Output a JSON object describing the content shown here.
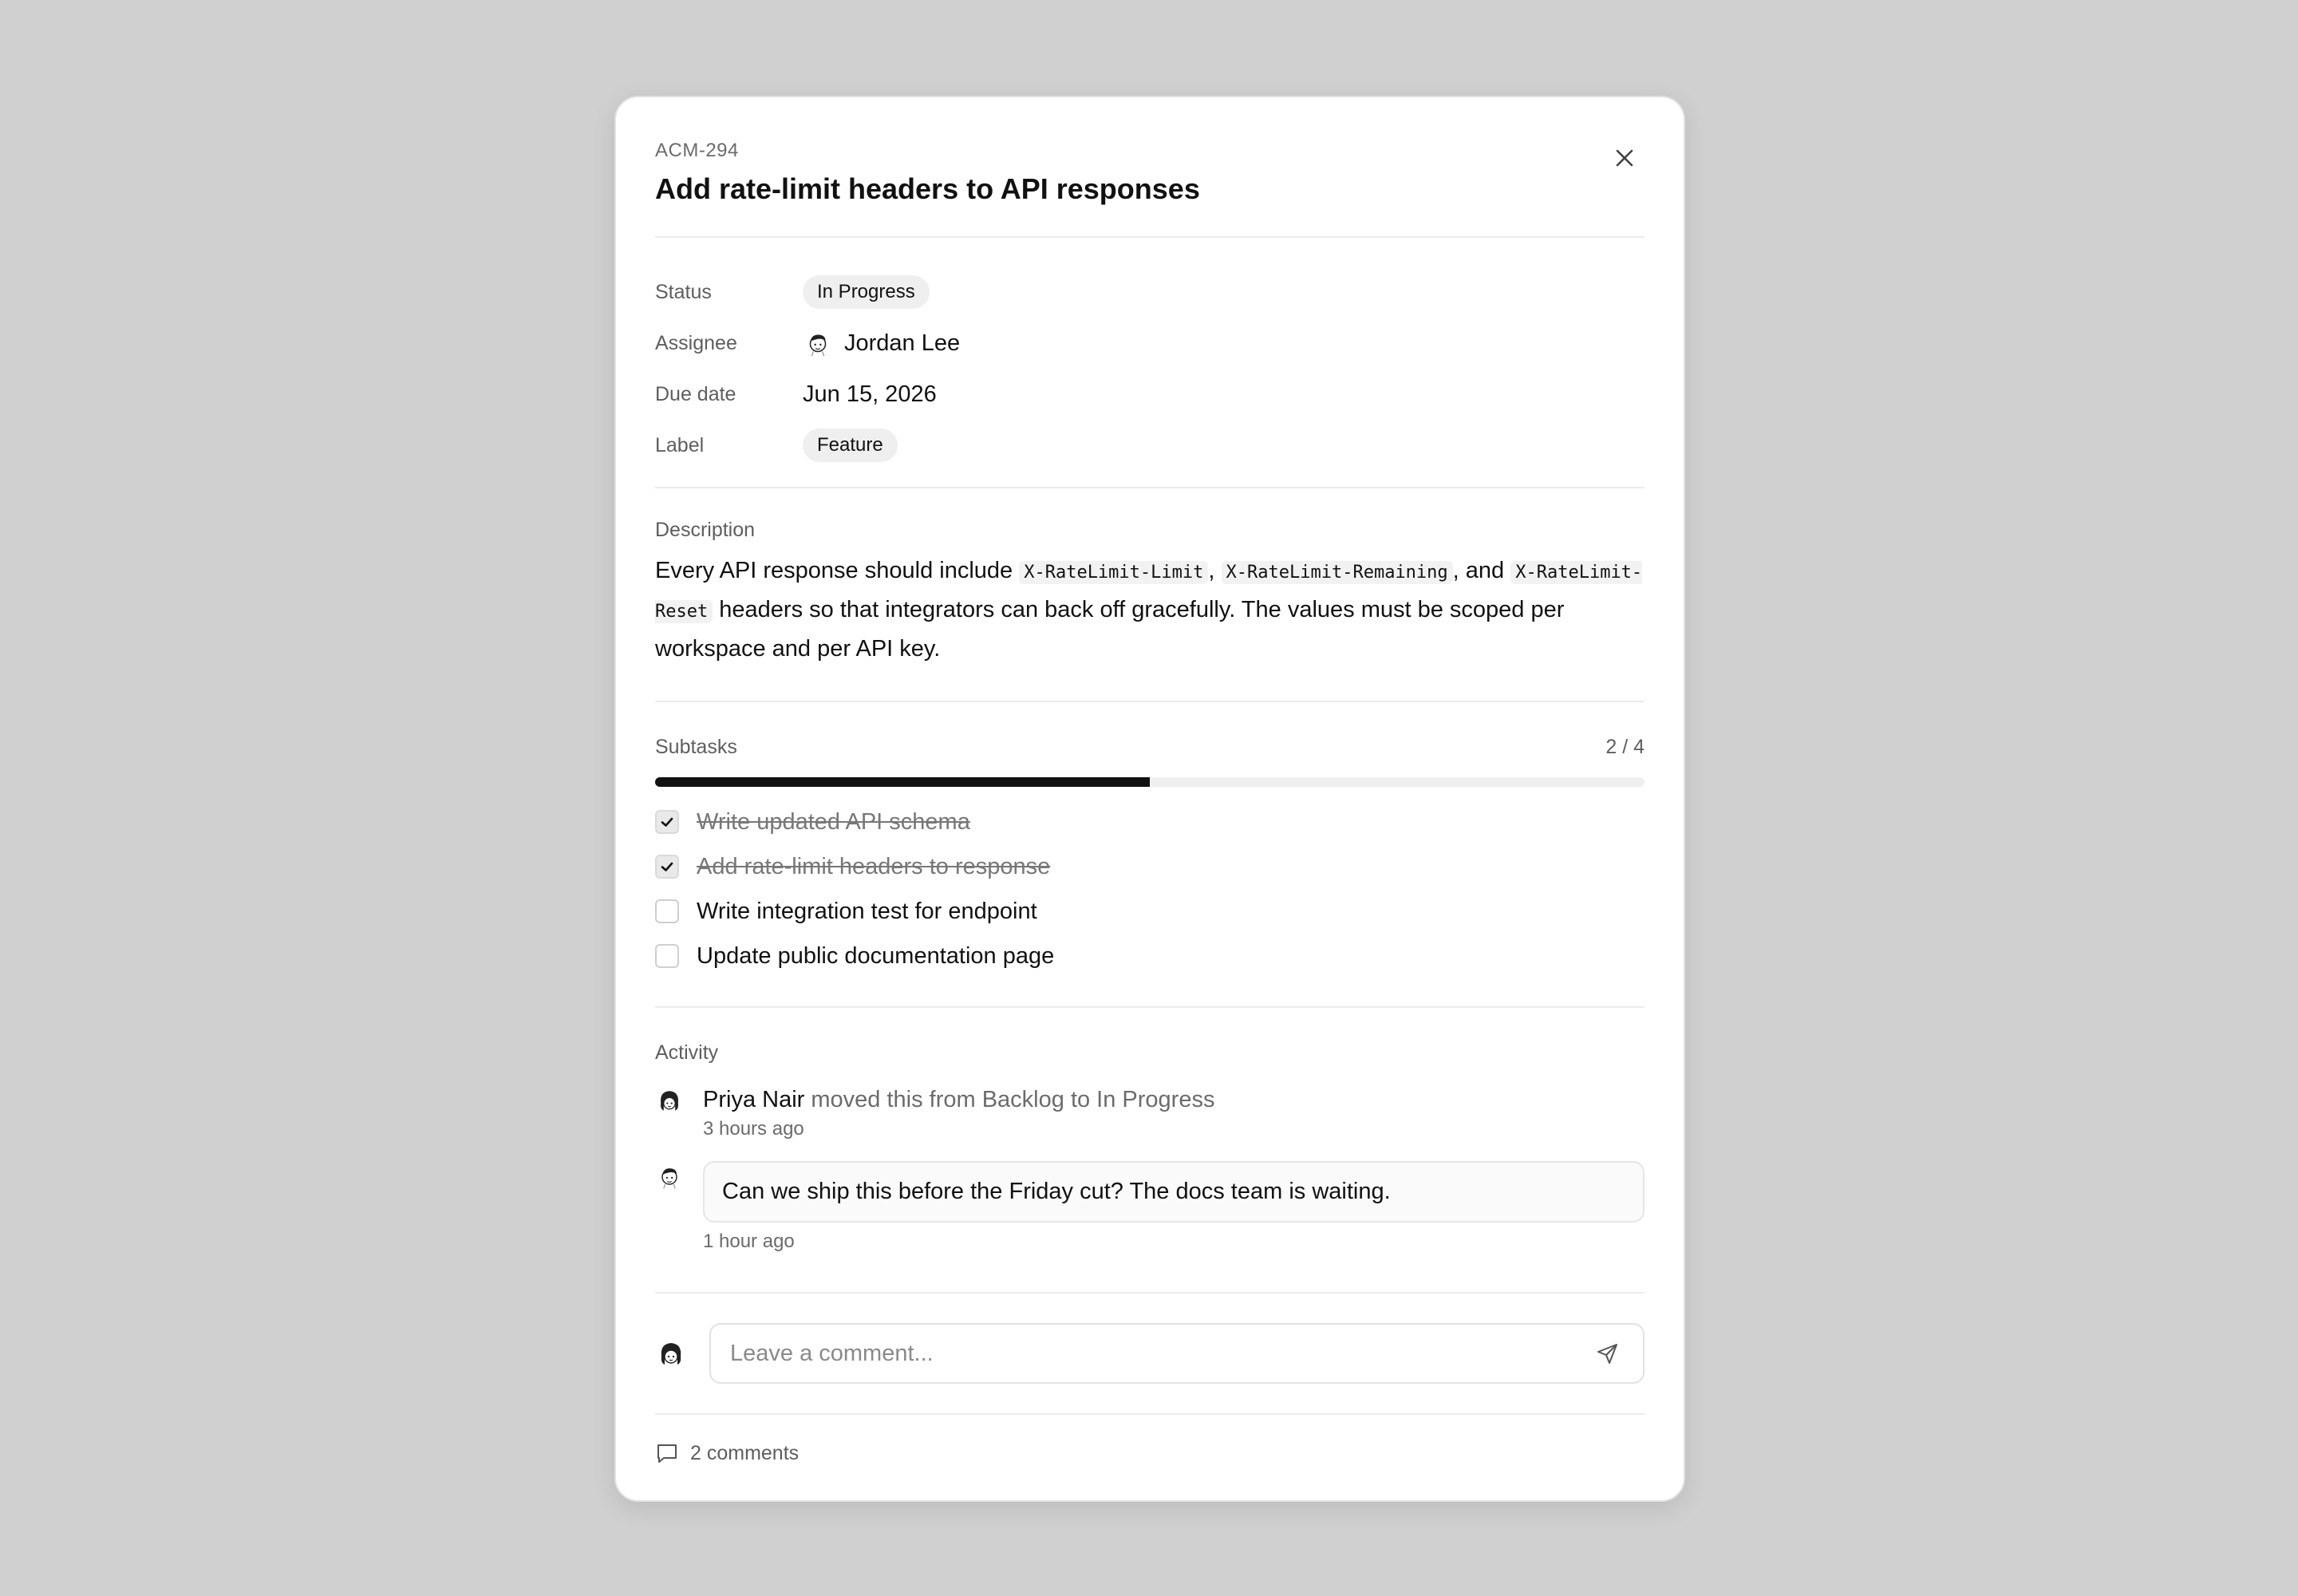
{
  "issue": {
    "id": "ACM-294",
    "title": "Add rate-limit headers to API responses"
  },
  "properties": {
    "status_label": "Status",
    "status_value": "In Progress",
    "assignee_label": "Assignee",
    "assignee_value": "Jordan Lee",
    "due_label": "Due date",
    "due_value": "Jun 15, 2026",
    "label_label": "Label",
    "label_value": "Feature"
  },
  "description": {
    "heading": "Description",
    "part1": "Every API response should include ",
    "code1": "X-RateLimit-Limit",
    "sep1": ", ",
    "code2": "X-RateLimit-Remaining",
    "sep2": ", and ",
    "code3": "X-RateLimit-Reset",
    "part2": " headers so that integrators can back off gracefully. The values must be scoped per workspace and per API key."
  },
  "subtasks": {
    "heading": "Subtasks",
    "count": "2 / 4",
    "progress": 0.5,
    "items": [
      {
        "text": "Write updated API schema",
        "done": true
      },
      {
        "text": "Add rate-limit headers to response",
        "done": true
      },
      {
        "text": "Write integration test for endpoint",
        "done": false
      },
      {
        "text": "Update public documentation page",
        "done": false
      }
    ]
  },
  "activity": {
    "heading": "Activity",
    "event": {
      "user": "Priya Nair",
      "action": " moved this from Backlog to In Progress",
      "time": "3 hours ago"
    },
    "comment": {
      "text": "Can we ship this before the Friday cut? The docs team is waiting.",
      "time": "1 hour ago"
    }
  },
  "composer": {
    "placeholder": "Leave a comment..."
  },
  "footer": {
    "comments": "2 comments"
  }
}
